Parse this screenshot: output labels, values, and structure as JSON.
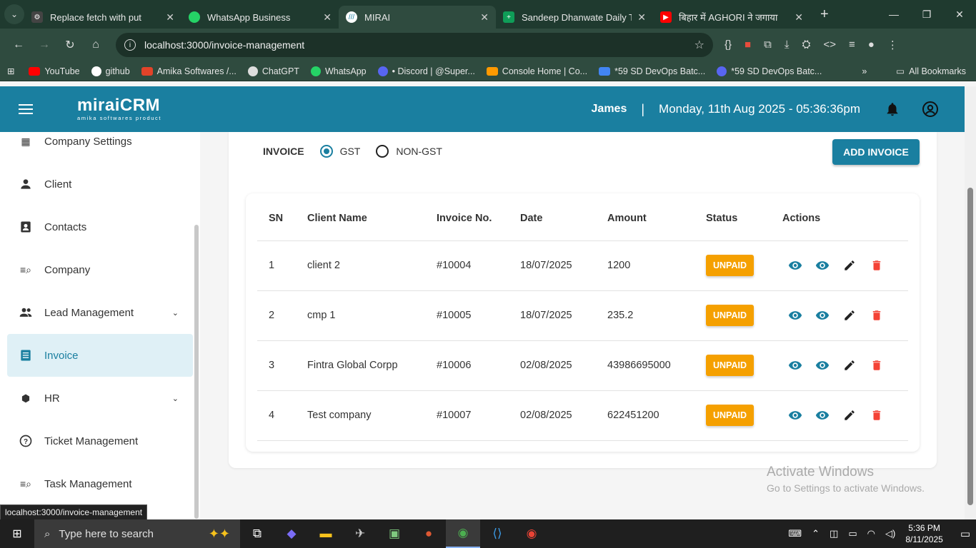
{
  "browser": {
    "tabs": [
      {
        "title": "Replace fetch with put",
        "favicon_color": "#444"
      },
      {
        "title": "WhatsApp Business",
        "favicon_color": "#25d366"
      },
      {
        "title": "MIRAI",
        "favicon_color": "#ffffff"
      },
      {
        "title": "Sandeep Dhanwate Daily Tas",
        "favicon_color": "#0f9d58"
      },
      {
        "title": "बिहार में AGHORI ने जगाया",
        "favicon_color": "#ff0000"
      }
    ],
    "url": "localhost:3000/invoice-management",
    "bookmarks": [
      {
        "label": "YouTube",
        "color": "#ff0000"
      },
      {
        "label": "github",
        "color": "#ffffff"
      },
      {
        "label": "Amika Softwares /...",
        "color": "#e24329"
      },
      {
        "label": "ChatGPT",
        "color": "#dddddd"
      },
      {
        "label": "WhatsApp",
        "color": "#25d366"
      },
      {
        "label": "• Discord | @Super...",
        "color": "#5865f2"
      },
      {
        "label": "Console Home | Co...",
        "color": "#ff9900"
      },
      {
        "label": "*59 SD DevOps Batc...",
        "color": "#4285f4"
      },
      {
        "label": "*59 SD DevOps Batc...",
        "color": "#5865f2"
      }
    ],
    "all_bookmarks": "All Bookmarks",
    "status_url": "localhost:3000/invoice-management"
  },
  "header": {
    "logo_main": "miraiCRM",
    "logo_sub": "amika softwares product",
    "user": "James",
    "separator": "|",
    "datetime": "Monday, 11th Aug 2025 - 05:36:36pm"
  },
  "sidebar": {
    "items": [
      {
        "label": "Company Settings"
      },
      {
        "label": "Client"
      },
      {
        "label": "Contacts"
      },
      {
        "label": "Company"
      },
      {
        "label": "Lead Management"
      },
      {
        "label": "Invoice"
      },
      {
        "label": "HR"
      },
      {
        "label": "Ticket Management"
      },
      {
        "label": "Task Management"
      }
    ]
  },
  "invoice": {
    "label": "INVOICE",
    "radio_gst": "GST",
    "radio_non_gst": "NON-GST",
    "add_button": "ADD INVOICE",
    "columns": [
      "SN",
      "Client Name",
      "Invoice No.",
      "Date",
      "Amount",
      "Status",
      "Actions"
    ],
    "rows": [
      {
        "sn": "1",
        "client": "client 2",
        "invoice_no": "#10004",
        "date": "18/07/2025",
        "amount": "1200",
        "status": "UNPAID"
      },
      {
        "sn": "2",
        "client": "cmp 1",
        "invoice_no": "#10005",
        "date": "18/07/2025",
        "amount": "235.2",
        "status": "UNPAID"
      },
      {
        "sn": "3",
        "client": "Fintra Global Corpp",
        "invoice_no": "#10006",
        "date": "02/08/2025",
        "amount": "43986695000",
        "status": "UNPAID"
      },
      {
        "sn": "4",
        "client": "Test company",
        "invoice_no": "#10007",
        "date": "02/08/2025",
        "amount": "622451200",
        "status": "UNPAID"
      }
    ]
  },
  "watermark": {
    "line1": "Activate Windows",
    "line2": "Go to Settings to activate Windows."
  },
  "taskbar": {
    "search_placeholder": "Type here to search",
    "time": "5:36 PM",
    "date": "8/11/2025"
  },
  "colors": {
    "primary": "#1a7fa0",
    "status_unpaid": "#f5a000",
    "delete": "#f44336"
  }
}
